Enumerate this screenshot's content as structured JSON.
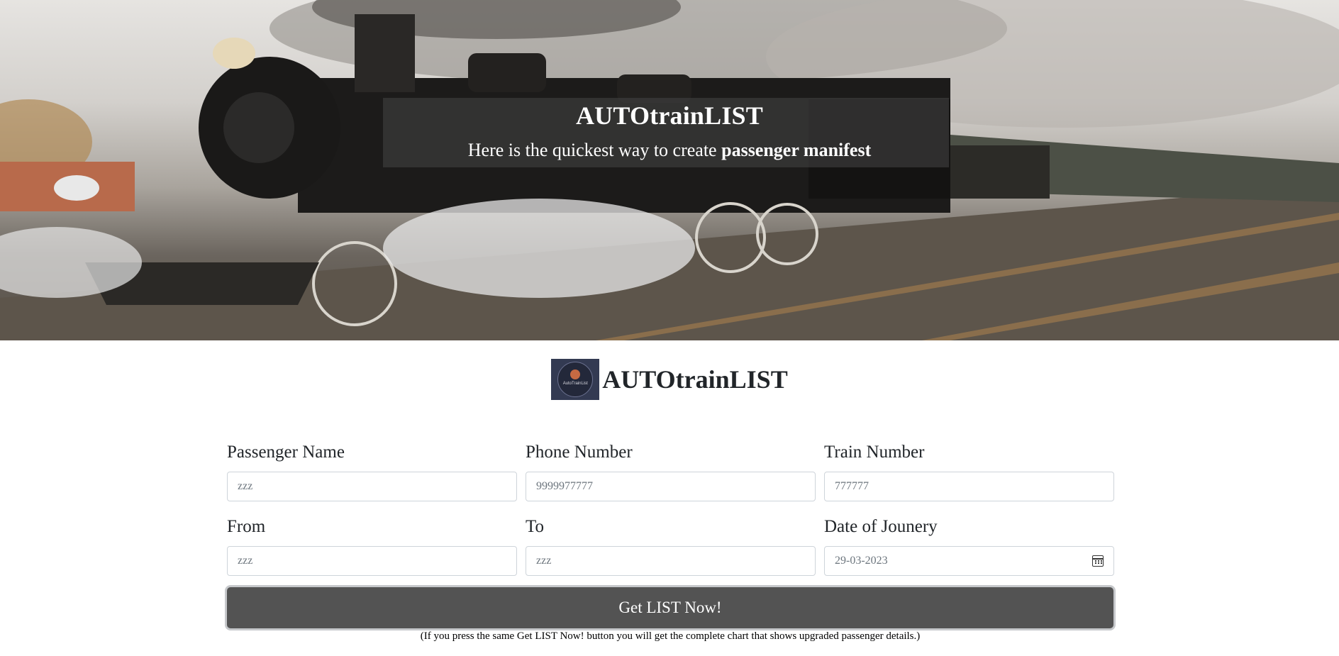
{
  "hero": {
    "title": "AUTOtrainLIST",
    "subtitle_prefix": "Here is the quickest way to create ",
    "subtitle_bold": "passenger manifest"
  },
  "brand": {
    "title": "AUTOtrainLIST",
    "logo_text": "AutoTrainList"
  },
  "form": {
    "fields": [
      {
        "label": "Passenger Name",
        "placeholder": "zzz"
      },
      {
        "label": "Phone Number",
        "placeholder": "9999977777"
      },
      {
        "label": "Train Number",
        "placeholder": "777777"
      },
      {
        "label": "From",
        "placeholder": "zzz"
      },
      {
        "label": "To",
        "placeholder": "zzz"
      },
      {
        "label": "Date of Jounery",
        "value": "29-03-2023",
        "icon": "calendar-icon"
      }
    ],
    "submit_label": "Get LIST Now!",
    "note": "(If you press the same Get LIST Now! button you will get the complete chart that shows upgraded passenger details.)"
  },
  "colors": {
    "button_bg": "#535353",
    "hero_banner": "rgba(70,70,70,0.55)",
    "text": "#212529"
  }
}
